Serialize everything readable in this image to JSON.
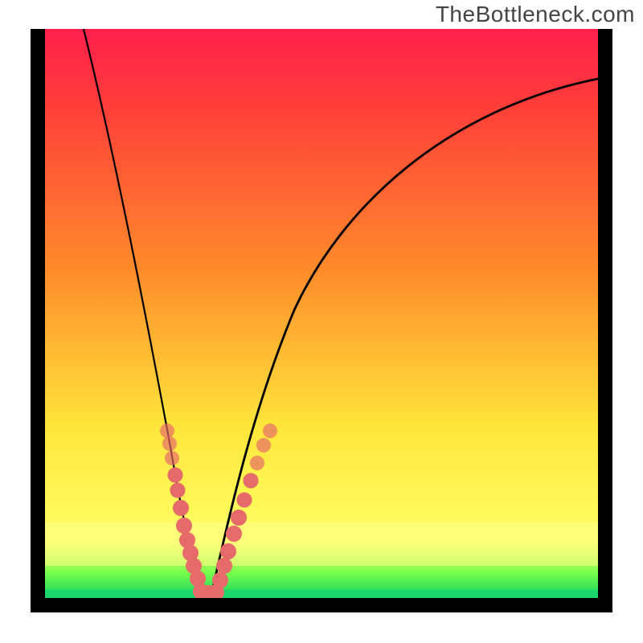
{
  "watermark": "TheBottleneck.com",
  "colors": {
    "frame": "#000000",
    "bead": "#e76a6a",
    "curve": "#000000",
    "gradient_top": "#ff1f4d",
    "gradient_red": "#ff3a3a",
    "gradient_orange": "#ff8a2a",
    "gradient_yellow": "#ffe63a",
    "gradient_lemon": "#ffff66",
    "gradient_lime": "#7aff4d",
    "gradient_green": "#10d060"
  },
  "chart_data": {
    "type": "line",
    "title": "",
    "xlabel": "",
    "ylabel": "",
    "xlim": [
      0,
      1
    ],
    "ylim": [
      0,
      1
    ],
    "series": [
      {
        "name": "left-curve",
        "x": [
          0.07,
          0.1,
          0.13,
          0.16,
          0.19,
          0.21,
          0.23,
          0.245,
          0.255,
          0.265,
          0.275,
          0.285
        ],
        "values": [
          1.0,
          0.87,
          0.71,
          0.55,
          0.4,
          0.28,
          0.18,
          0.11,
          0.07,
          0.04,
          0.02,
          0.005
        ]
      },
      {
        "name": "right-curve",
        "x": [
          0.3,
          0.32,
          0.35,
          0.38,
          0.41,
          0.45,
          0.5,
          0.56,
          0.63,
          0.72,
          0.83,
          0.98
        ],
        "values": [
          0.005,
          0.06,
          0.15,
          0.25,
          0.34,
          0.43,
          0.53,
          0.63,
          0.72,
          0.8,
          0.86,
          0.9
        ]
      }
    ],
    "annotations": [
      {
        "name": "beads-left",
        "type": "points",
        "series": "left-curve",
        "y_range": [
          0.005,
          0.3
        ]
      },
      {
        "name": "beads-right",
        "type": "points",
        "series": "right-curve",
        "y_range": [
          0.005,
          0.3
        ]
      },
      {
        "name": "beads-bottom",
        "type": "points",
        "x_range": [
          0.275,
          0.31
        ],
        "y": 0.003
      }
    ]
  }
}
